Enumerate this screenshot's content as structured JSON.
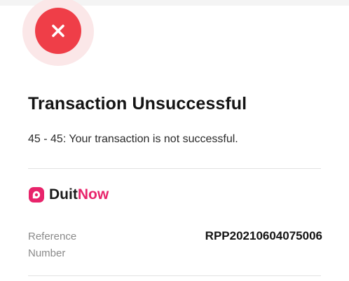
{
  "status": {
    "icon": "close-icon",
    "accent_color": "#ef3e48",
    "halo_color": "#fbe7e8"
  },
  "title": "Transaction Unsuccessful",
  "message": "45 - 45: Your transaction is not successful.",
  "brand": {
    "name_part1": "Duit",
    "name_part2": "Now",
    "logo_icon": "duitnow-logo-icon",
    "brand_color": "#e8246b"
  },
  "reference": {
    "label_line1": "Reference",
    "label_line2": "Number",
    "value": "RPP20210604075006"
  }
}
